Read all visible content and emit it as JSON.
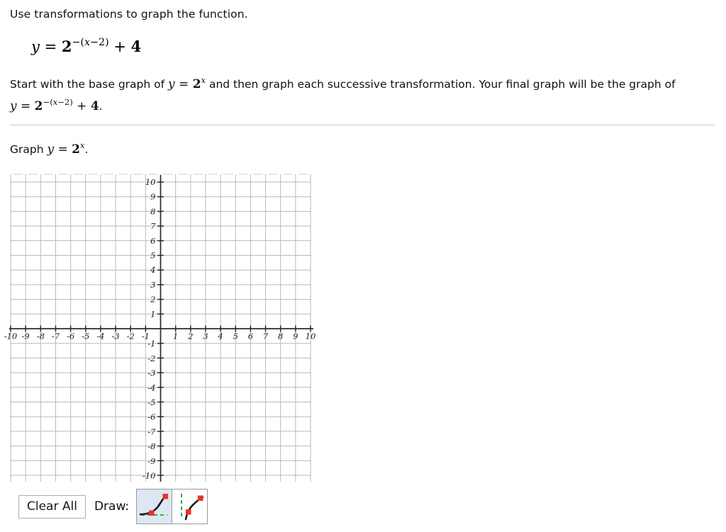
{
  "prompt": {
    "instruction": "Use transformations to graph the function.",
    "equation_plain": "y = 2^-(x-2) + 4",
    "paragraph_part1": "Start with the base graph of ",
    "paragraph_eq1_plain": "y = 2^x",
    "paragraph_part2": " and then graph each successive transformation. Your final graph will be the graph of ",
    "paragraph_eq2_plain": "y = 2^-(x-2) + 4",
    "paragraph_part3": "."
  },
  "task": {
    "graph_label_prefix": "Graph ",
    "graph_label_equation_plain": "y = 2^x",
    "graph_label_suffix": "."
  },
  "graph": {
    "x_axis_labels": [
      "-10",
      "-9",
      "-8",
      "-7",
      "-6",
      "-5",
      "-4",
      "-3",
      "-2",
      "-1",
      "1",
      "2",
      "3",
      "4",
      "5",
      "6",
      "7",
      "8",
      "9",
      "10"
    ],
    "y_axis_labels": [
      "10",
      "9",
      "8",
      "7",
      "6",
      "5",
      "4",
      "3",
      "2",
      "1",
      "-1",
      "-2",
      "-3",
      "-4",
      "-5",
      "-6",
      "-7",
      "-8",
      "-9",
      "-10"
    ],
    "x_min": -10,
    "x_max": 10,
    "y_min": -10,
    "y_max": 10,
    "grid_step": 1,
    "grid_color": "#b9b9b9",
    "axis_color": "#2b2b2b",
    "label_color": "#1a1a1a"
  },
  "toolbar": {
    "clear_all_label": "Clear All",
    "draw_label": "Draw:",
    "tools": [
      {
        "name": "exponential-curve-tool",
        "selected": true,
        "asymptote": "horizontal",
        "curve_color": "#1a1a1a",
        "point_color": "#ee3124",
        "asymptote_color": "#3fa34d"
      },
      {
        "name": "logarithmic-curve-tool",
        "selected": false,
        "asymptote": "vertical",
        "curve_color": "#1a1a1a",
        "point_color": "#ee3124",
        "asymptote_color": "#3fa34d"
      }
    ]
  },
  "chart_data": {
    "type": "line",
    "title": "",
    "xlabel": "",
    "ylabel": "",
    "xlim": [
      -10,
      10
    ],
    "ylim": [
      -10,
      10
    ],
    "grid": true,
    "legend": "none",
    "series": [],
    "note": "Empty coordinate grid awaiting user-drawn graph of y = 2^x"
  }
}
